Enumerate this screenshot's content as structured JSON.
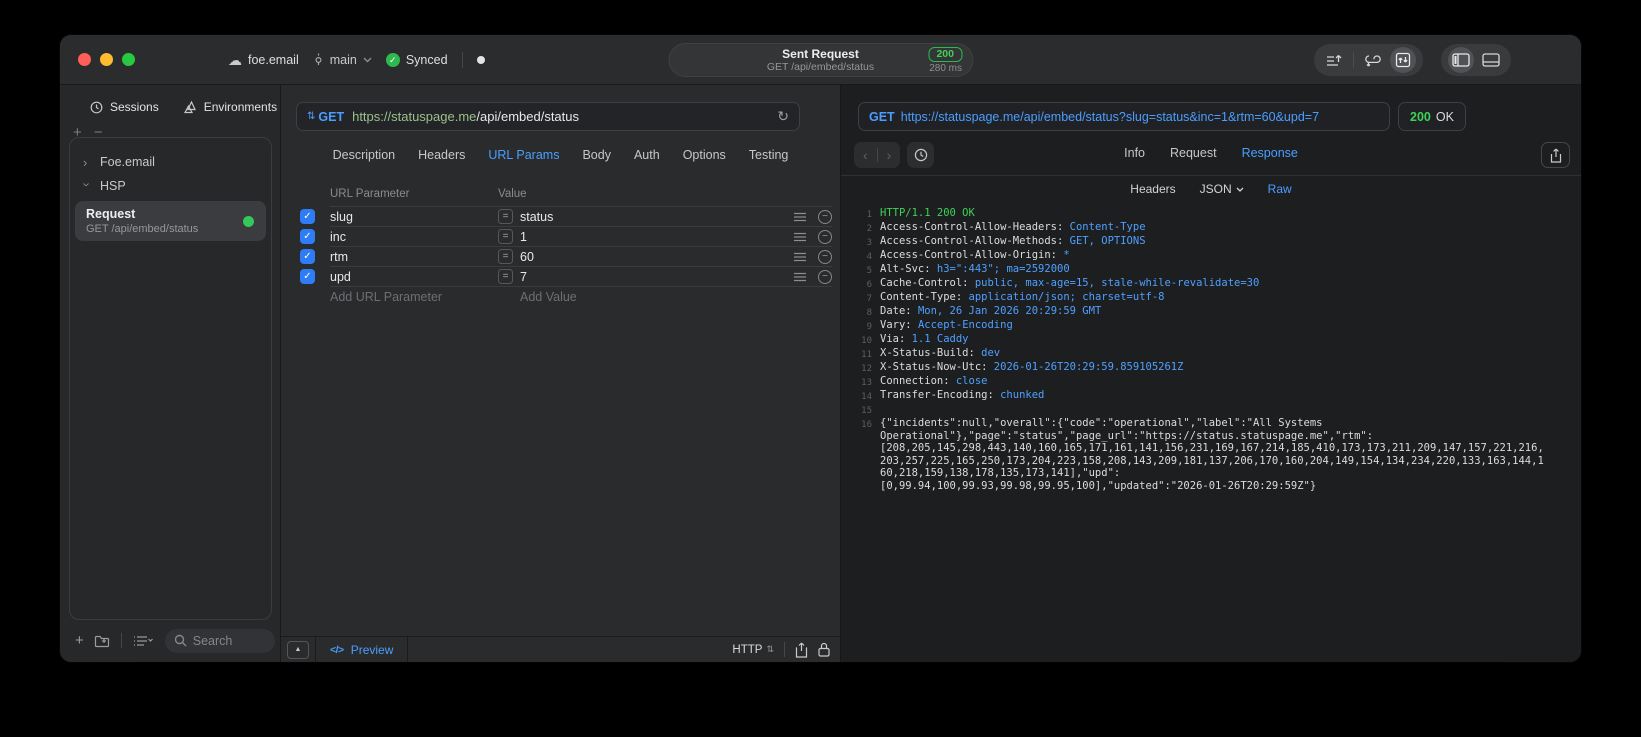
{
  "titlebar": {
    "project": "foe.email",
    "branch": "main",
    "sync_status": "Synced",
    "request_title": "Sent Request",
    "request_subtitle": "GET /api/embed/status",
    "status_code": "200",
    "duration": "280 ms"
  },
  "sidebar": {
    "tabs": [
      {
        "label": "Sessions"
      },
      {
        "label": "Environments"
      }
    ],
    "tree": [
      {
        "label": "Foe.email",
        "expanded": false
      },
      {
        "label": "HSP",
        "expanded": true
      }
    ],
    "selected_request": {
      "title": "Request",
      "subtitle": "GET /api/embed/status"
    },
    "search_placeholder": "Search"
  },
  "request_pane": {
    "method": "GET",
    "url_host": "https://statuspage.me",
    "url_path": "/api/embed/status",
    "tabs": [
      "Description",
      "Headers",
      "URL Params",
      "Body",
      "Auth",
      "Options",
      "Testing"
    ],
    "active_tab": "URL Params",
    "params": {
      "col_name": "URL Parameter",
      "col_value": "Value",
      "rows": [
        {
          "name": "slug",
          "value": "status",
          "enabled": true
        },
        {
          "name": "inc",
          "value": "1",
          "enabled": true
        },
        {
          "name": "rtm",
          "value": "60",
          "enabled": true
        },
        {
          "name": "upd",
          "value": "7",
          "enabled": true
        }
      ],
      "add_name_placeholder": "Add URL Parameter",
      "add_value_placeholder": "Add Value"
    },
    "footer": {
      "preview_label": "Preview",
      "protocol": "HTTP"
    }
  },
  "response_pane": {
    "method": "GET",
    "url": "https://statuspage.me/api/embed/status?slug=status&inc=1&rtm=60&upd=7",
    "status_code": "200",
    "status_text": "OK",
    "tabs": [
      "Info",
      "Request",
      "Response"
    ],
    "active_tab": "Response",
    "subtabs": [
      "Headers",
      "JSON",
      "Raw"
    ],
    "active_subtab": "Raw",
    "lines": [
      {
        "n": 1,
        "parts": [
          {
            "t": "HTTP/1.1 200 OK",
            "c": "green"
          }
        ]
      },
      {
        "n": 2,
        "parts": [
          {
            "t": "Access-Control-Allow-Headers: ",
            "c": "plain"
          },
          {
            "t": "Content-Type",
            "c": "blue"
          }
        ]
      },
      {
        "n": 3,
        "parts": [
          {
            "t": "Access-Control-Allow-Methods: ",
            "c": "plain"
          },
          {
            "t": "GET, OPTIONS",
            "c": "blue"
          }
        ]
      },
      {
        "n": 4,
        "parts": [
          {
            "t": "Access-Control-Allow-Origin: ",
            "c": "plain"
          },
          {
            "t": "*",
            "c": "blue"
          }
        ]
      },
      {
        "n": 5,
        "parts": [
          {
            "t": "Alt-Svc: ",
            "c": "plain"
          },
          {
            "t": "h3=\":443\"; ma=2592000",
            "c": "blue"
          }
        ]
      },
      {
        "n": 6,
        "parts": [
          {
            "t": "Cache-Control: ",
            "c": "plain"
          },
          {
            "t": "public, max-age=15, stale-while-revalidate=30",
            "c": "blue"
          }
        ]
      },
      {
        "n": 7,
        "parts": [
          {
            "t": "Content-Type: ",
            "c": "plain"
          },
          {
            "t": "application/json; charset=utf-8",
            "c": "blue"
          }
        ]
      },
      {
        "n": 8,
        "parts": [
          {
            "t": "Date: ",
            "c": "plain"
          },
          {
            "t": "Mon, 26 Jan 2026 20:29:59 GMT",
            "c": "blue"
          }
        ]
      },
      {
        "n": 9,
        "parts": [
          {
            "t": "Vary: ",
            "c": "plain"
          },
          {
            "t": "Accept-Encoding",
            "c": "blue"
          }
        ]
      },
      {
        "n": 10,
        "parts": [
          {
            "t": "Via: ",
            "c": "plain"
          },
          {
            "t": "1.1 Caddy",
            "c": "blue"
          }
        ]
      },
      {
        "n": 11,
        "parts": [
          {
            "t": "X-Status-Build: ",
            "c": "plain"
          },
          {
            "t": "dev",
            "c": "blue"
          }
        ]
      },
      {
        "n": 12,
        "parts": [
          {
            "t": "X-Status-Now-Utc: ",
            "c": "plain"
          },
          {
            "t": "2026-01-26T20:29:59.859105261Z",
            "c": "blue"
          }
        ]
      },
      {
        "n": 13,
        "parts": [
          {
            "t": "Connection: ",
            "c": "plain"
          },
          {
            "t": "close",
            "c": "blue"
          }
        ]
      },
      {
        "n": 14,
        "parts": [
          {
            "t": "Transfer-Encoding: ",
            "c": "plain"
          },
          {
            "t": "chunked",
            "c": "blue"
          }
        ]
      },
      {
        "n": 15,
        "parts": []
      },
      {
        "n": 16,
        "parts": [
          {
            "t": "{\"incidents\":null,\"overall\":{\"code\":\"operational\",\"label\":\"All Systems\nOperational\"},\"page\":\"status\",\"page_url\":\"https://status.statuspage.me\",\"rtm\":\n[208,205,145,298,443,140,160,165,171,161,141,156,231,169,167,214,185,410,173,173,211,209,147,157,221,216,\n203,257,225,165,250,173,204,223,158,208,143,209,181,137,206,170,160,204,149,154,134,234,220,133,163,144,1\n60,218,159,138,178,135,173,141],\"upd\":\n[0,99.94,100,99.93,99.98,99.95,100],\"updated\":\"2026-01-26T20:29:59Z\"}",
            "c": "plain"
          }
        ]
      }
    ]
  },
  "icons": {
    "cloud": "☁",
    "check": "✓",
    "plus": "+",
    "minus": "−",
    "chevron_right": "›",
    "back": "‹",
    "forward": "›",
    "updown": "⇅",
    "refresh": "↻",
    "code": "</>",
    "triangle_up": "▲",
    "equals": "=",
    "dot": "●"
  },
  "colors": {
    "accent_blue": "#4B9EFF",
    "status_green": "#3FD158",
    "checkbox_blue": "#2E7CF6",
    "bg_window": "#2A2B2D",
    "bg_response": "#1D1E20",
    "badge_green_border": "#2FB84F"
  }
}
